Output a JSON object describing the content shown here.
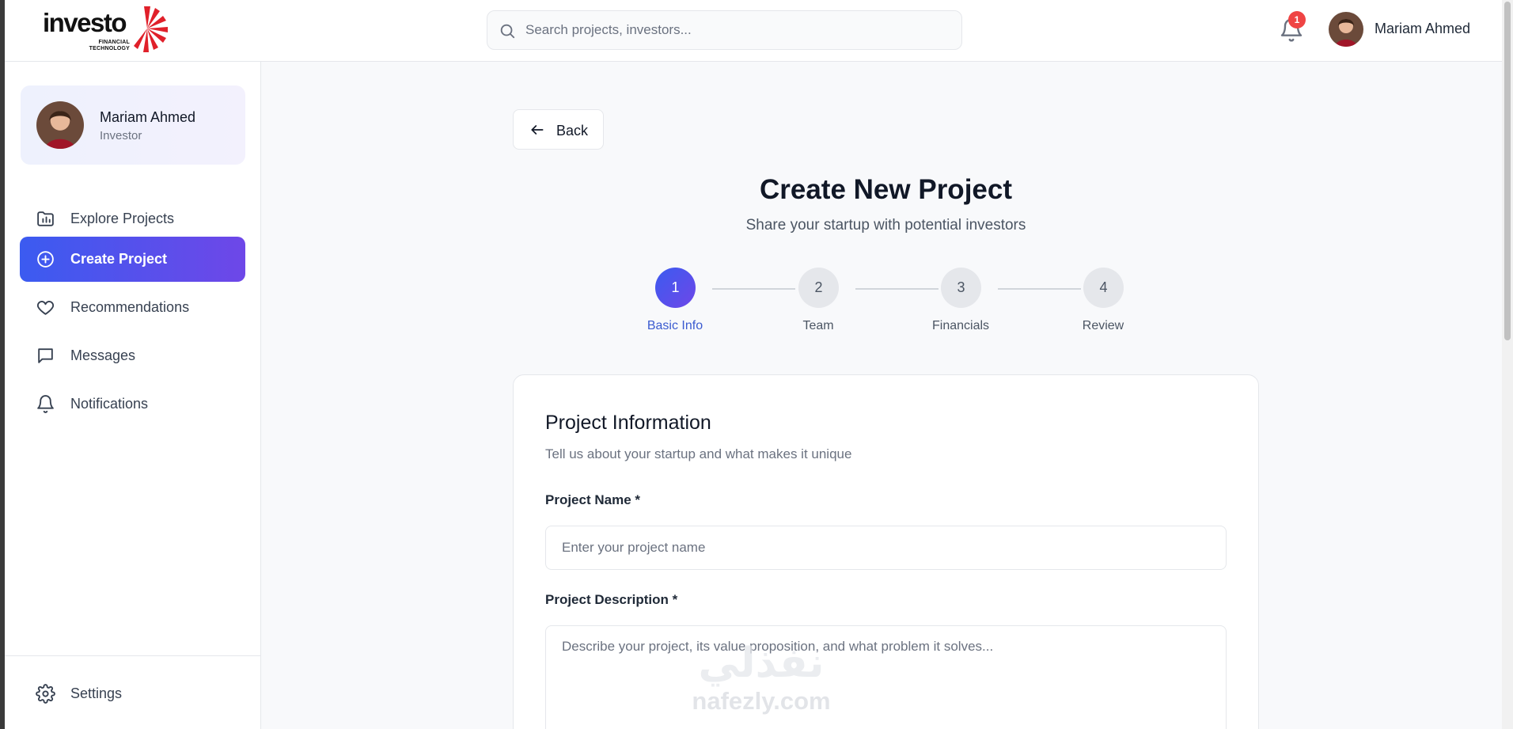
{
  "brand": {
    "name": "investo",
    "tagline_line1": "FINANCIAL",
    "tagline_line2": "TECHNOLOGY",
    "accent_color": "#e0202a"
  },
  "header": {
    "search_placeholder": "Search projects, investors...",
    "notification_count": "1",
    "user_name": "Mariam Ahmed"
  },
  "sidebar": {
    "profile": {
      "name": "Mariam Ahmed",
      "role": "Investor"
    },
    "items": [
      {
        "label": "Explore Projects",
        "icon": "folder-chart-icon",
        "active": false
      },
      {
        "label": "Create Project",
        "icon": "plus-circle-icon",
        "active": true
      },
      {
        "label": "Recommendations",
        "icon": "heart-icon",
        "active": false
      },
      {
        "label": "Messages",
        "icon": "message-square-icon",
        "active": false
      },
      {
        "label": "Notifications",
        "icon": "bell-icon",
        "active": false
      }
    ],
    "settings_label": "Settings"
  },
  "main": {
    "back_label": "Back",
    "title": "Create New Project",
    "subtitle": "Share your startup with potential investors",
    "steps": [
      {
        "number": "1",
        "label": "Basic Info",
        "active": true
      },
      {
        "number": "2",
        "label": "Team",
        "active": false
      },
      {
        "number": "3",
        "label": "Financials",
        "active": false
      },
      {
        "number": "4",
        "label": "Review",
        "active": false
      }
    ],
    "form": {
      "title": "Project Information",
      "description": "Tell us about your startup and what makes it unique",
      "name_label": "Project Name *",
      "name_placeholder": "Enter your project name",
      "name_value": "",
      "desc_label": "Project Description *",
      "desc_placeholder": "Describe your project, its value proposition, and what problem it solves...",
      "desc_value": ""
    }
  },
  "watermark": {
    "arabic": "نفذلي",
    "latin": "nafezly.com"
  },
  "colors": {
    "primary_start": "#3b5bf0",
    "primary_end": "#6e47e8",
    "badge": "#ef4444"
  }
}
